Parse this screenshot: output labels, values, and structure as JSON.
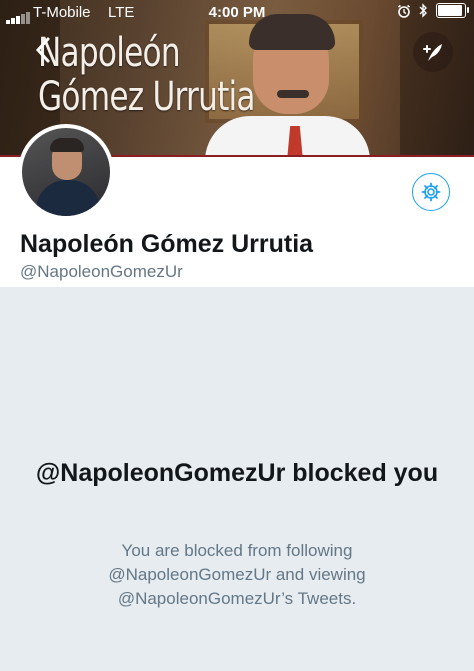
{
  "status_bar": {
    "carrier": "T-Mobile",
    "network": "LTE",
    "time": "4:00 PM",
    "battery_level": 0.85
  },
  "banner": {
    "title_line1": "Napoleón",
    "title_line2": "Gómez Urrutia",
    "accent_color": "#8b1e22"
  },
  "nav": {
    "back_icon": "chevron-left-icon",
    "compose_icon": "compose-feather-icon"
  },
  "profile": {
    "name": "Napoleón Gómez Urrutia",
    "handle": "@NapoleonGomezUr",
    "settings_icon": "gear-icon",
    "accent_color": "#1da1f2"
  },
  "blocked": {
    "heading": "@NapoleonGomezUr blocked you",
    "message_line1": "You are blocked from following",
    "message_line2": "@NapoleonGomezUr and viewing",
    "message_line3": "@NapoleonGomezUr’s Tweets."
  }
}
